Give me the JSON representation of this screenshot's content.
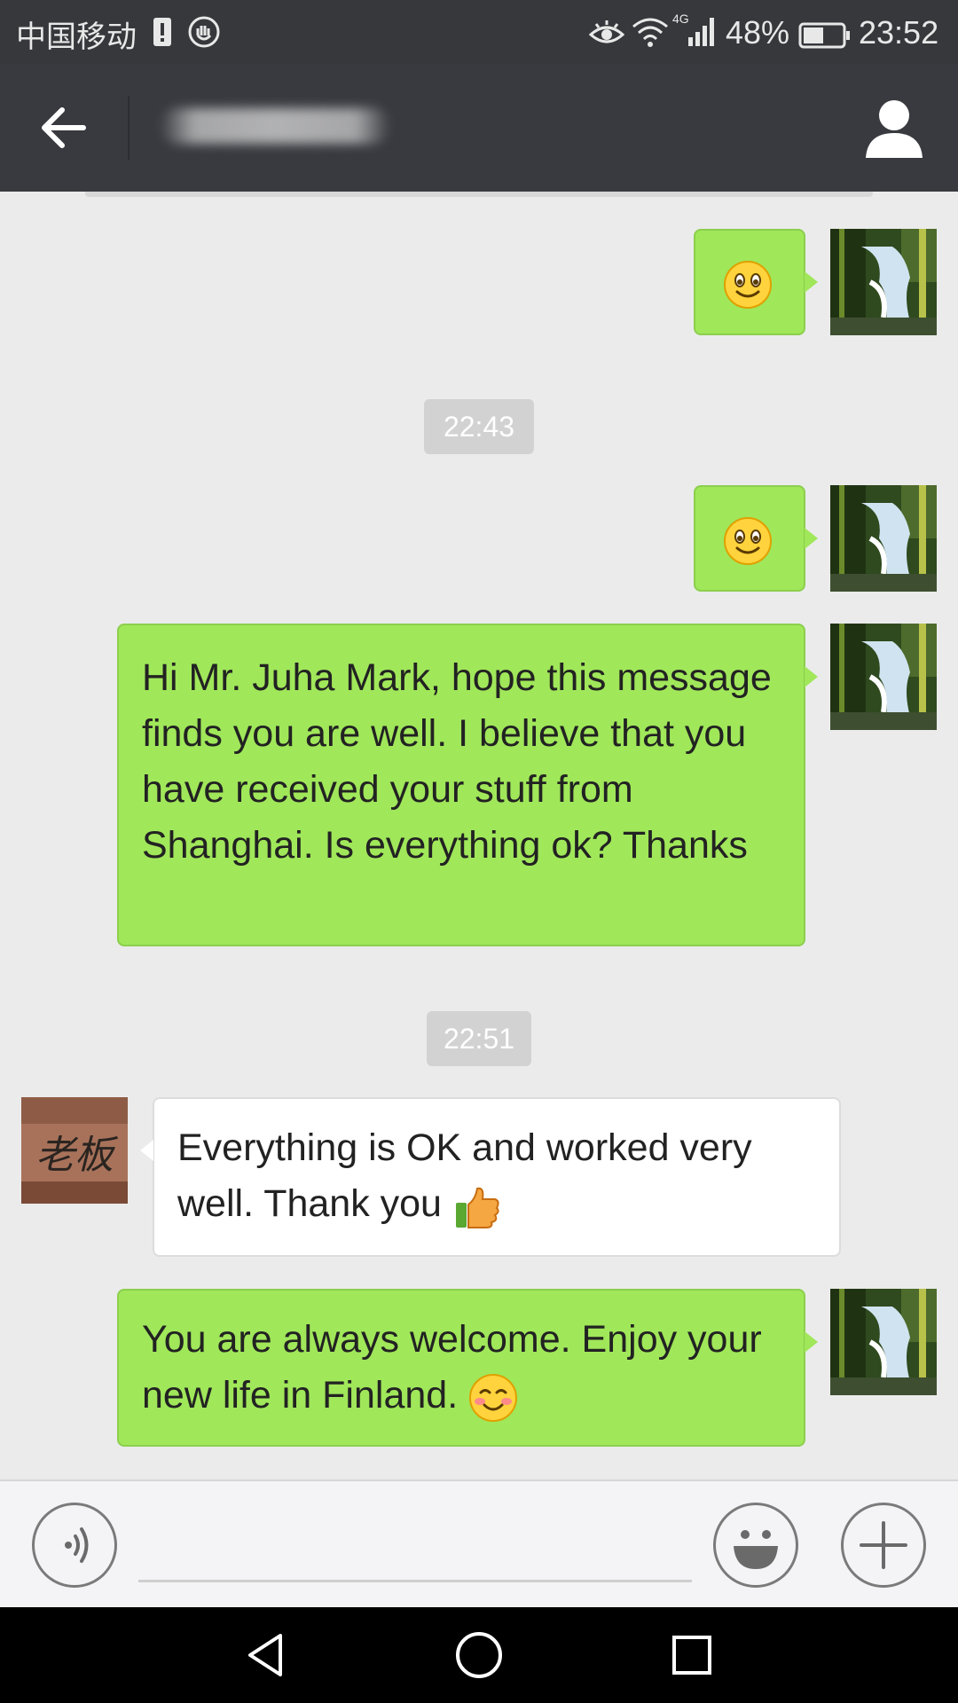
{
  "status_bar": {
    "carrier": "中国移动",
    "network": "4G",
    "battery_percent": "48%",
    "time": "23:52"
  },
  "header": {
    "contact_name": "",
    "back_icon": "arrow-left-icon",
    "profile_icon": "person-icon"
  },
  "messages": [
    {
      "sender": "me",
      "type": "emoji",
      "emoji": "smile-emoji"
    },
    {
      "type": "timestamp",
      "text": "22:43"
    },
    {
      "sender": "me",
      "type": "emoji",
      "emoji": "smile-emoji"
    },
    {
      "sender": "me",
      "type": "text",
      "text": "Hi Mr. Juha Mark, hope this message finds you are well. I believe that you have received your stuff from Shanghai. Is everything ok? Thanks"
    },
    {
      "type": "timestamp",
      "text": "22:51"
    },
    {
      "sender": "contact",
      "type": "text",
      "text": "Everything is OK and worked very well. Thank you",
      "trailing_emoji": "thumbs-up-emoji"
    },
    {
      "sender": "me",
      "type": "text",
      "text": "You are always welcome. Enjoy your new life in Finland.",
      "trailing_emoji": "blush-smile-emoji"
    }
  ],
  "contact_avatar_text": "老板",
  "input_bar": {
    "voice_icon": "voice-icon",
    "input_value": "",
    "emoji_icon": "emoji-face-icon",
    "plus_icon": "plus-icon"
  },
  "colors": {
    "status_bar_bg": "#36383c",
    "header_bg": "#393a3f",
    "chat_bg": "#ebebeb",
    "my_bubble": "#a0e75a",
    "their_bubble": "#ffffff"
  }
}
